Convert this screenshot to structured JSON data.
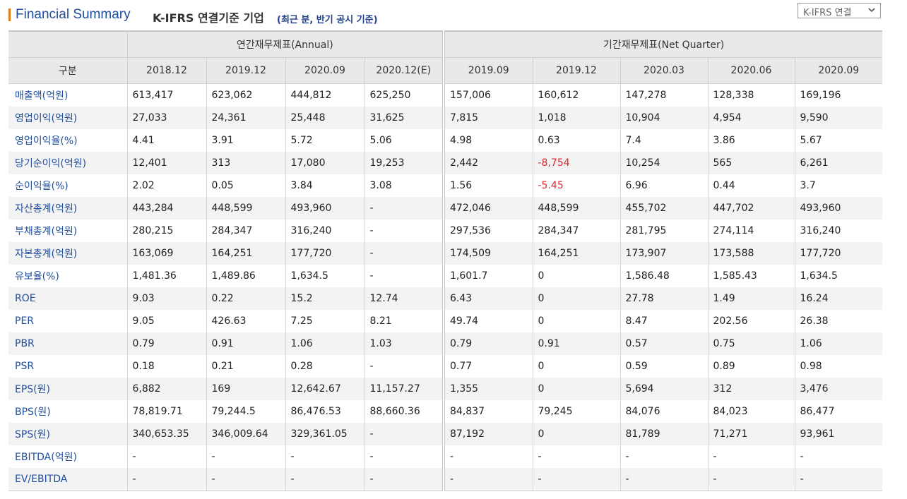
{
  "header": {
    "title": "Financial Summary",
    "subtitle": "K-IFRS 연결기준 기업",
    "note": "(최근 분, 반기 공시 기준)",
    "select_value": "K-IFRS 연결"
  },
  "table": {
    "corner_label": "구분",
    "annual_group": "연간재무제표(Annual)",
    "quarter_group": "기간재무제표(Net Quarter)",
    "annual_periods": [
      "2018.12",
      "2019.12",
      "2020.09",
      "2020.12(E)"
    ],
    "quarter_periods": [
      "2019.09",
      "2019.12",
      "2020.03",
      "2020.06",
      "2020.09"
    ],
    "rows": [
      {
        "label": "매출액(억원)",
        "values": [
          "613,417",
          "623,062",
          "444,812",
          "625,250",
          "157,006",
          "160,612",
          "147,278",
          "128,338",
          "169,196"
        ]
      },
      {
        "label": "영업이익(억원)",
        "values": [
          "27,033",
          "24,361",
          "25,448",
          "31,625",
          "7,815",
          "1,018",
          "10,904",
          "4,954",
          "9,590"
        ]
      },
      {
        "label": "영업이익율(%)",
        "values": [
          "4.41",
          "3.91",
          "5.72",
          "5.06",
          "4.98",
          "0.63",
          "7.4",
          "3.86",
          "5.67"
        ]
      },
      {
        "label": "당기순이익(억원)",
        "values": [
          "12,401",
          "313",
          "17,080",
          "19,253",
          "2,442",
          "-8,754",
          "10,254",
          "565",
          "6,261"
        ]
      },
      {
        "label": "순이익율(%)",
        "values": [
          "2.02",
          "0.05",
          "3.84",
          "3.08",
          "1.56",
          "-5.45",
          "6.96",
          "0.44",
          "3.7"
        ]
      },
      {
        "label": "자산총계(억원)",
        "values": [
          "443,284",
          "448,599",
          "493,960",
          "-",
          "472,046",
          "448,599",
          "455,702",
          "447,702",
          "493,960"
        ]
      },
      {
        "label": "부채총계(억원)",
        "values": [
          "280,215",
          "284,347",
          "316,240",
          "-",
          "297,536",
          "284,347",
          "281,795",
          "274,114",
          "316,240"
        ]
      },
      {
        "label": "자본총계(억원)",
        "values": [
          "163,069",
          "164,251",
          "177,720",
          "-",
          "174,509",
          "164,251",
          "173,907",
          "173,588",
          "177,720"
        ]
      },
      {
        "label": "유보율(%)",
        "values": [
          "1,481.36",
          "1,489.86",
          "1,634.5",
          "-",
          "1,601.7",
          "0",
          "1,586.48",
          "1,585.43",
          "1,634.5"
        ]
      },
      {
        "label": "ROE",
        "values": [
          "9.03",
          "0.22",
          "15.2",
          "12.74",
          "6.43",
          "0",
          "27.78",
          "1.49",
          "16.24"
        ]
      },
      {
        "label": "PER",
        "values": [
          "9.05",
          "426.63",
          "7.25",
          "8.21",
          "49.74",
          "0",
          "8.47",
          "202.56",
          "26.38"
        ]
      },
      {
        "label": "PBR",
        "values": [
          "0.79",
          "0.91",
          "1.06",
          "1.03",
          "0.79",
          "0.91",
          "0.57",
          "0.75",
          "1.06"
        ]
      },
      {
        "label": "PSR",
        "values": [
          "0.18",
          "0.21",
          "0.28",
          "-",
          "0.77",
          "0",
          "0.59",
          "0.89",
          "0.98"
        ]
      },
      {
        "label": "EPS(원)",
        "values": [
          "6,882",
          "169",
          "12,642.67",
          "11,157.27",
          "1,355",
          "0",
          "5,694",
          "312",
          "3,476"
        ]
      },
      {
        "label": "BPS(원)",
        "values": [
          "78,819.71",
          "79,244.5",
          "86,476.53",
          "88,660.36",
          "84,837",
          "79,245",
          "84,076",
          "84,023",
          "86,477"
        ]
      },
      {
        "label": "SPS(원)",
        "values": [
          "340,653.35",
          "346,009.64",
          "329,361.05",
          "-",
          "87,192",
          "0",
          "81,789",
          "71,271",
          "93,961"
        ]
      },
      {
        "label": "EBITDA(억원)",
        "values": [
          "-",
          "-",
          "-",
          "-",
          "-",
          "-",
          "-",
          "-",
          "-"
        ]
      },
      {
        "label": "EV/EBITDA",
        "values": [
          "-",
          "-",
          "-",
          "-",
          "-",
          "-",
          "-",
          "-",
          "-"
        ]
      }
    ]
  },
  "colors": {
    "title": "#1f4e9c",
    "accent_bar": "#e07b1a",
    "negative": "#e0282e",
    "header_bg": "#e9e9e9",
    "stripe_bg": "#f3f3f3"
  },
  "icons": {
    "select_arrow": "chevron-down-icon"
  }
}
